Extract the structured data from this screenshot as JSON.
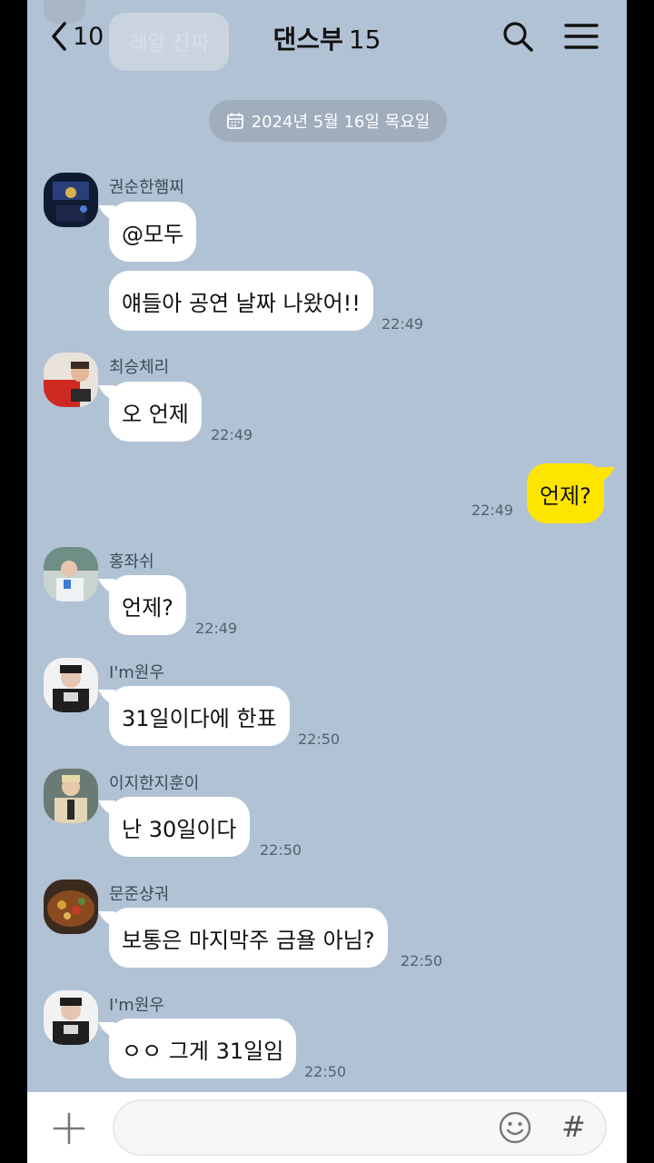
{
  "header": {
    "back_count": "10",
    "title": "댄스부",
    "member_count": "15",
    "ghost_text": "레알 진짜"
  },
  "date_divider": "2024년 5월 16일 목요일",
  "messages": [
    {
      "sender": "권순한햄찌",
      "texts": [
        "@모두",
        "얘들아 공연 날짜 나왔어!!"
      ],
      "time": "22:49"
    },
    {
      "sender": "최승체리",
      "texts": [
        "오 언제"
      ],
      "time": "22:49"
    },
    {
      "mine": true,
      "texts": [
        "언제?"
      ],
      "time": "22:49"
    },
    {
      "sender": "홍좌쉬",
      "texts": [
        "언제?"
      ],
      "time": "22:49"
    },
    {
      "sender": "I'm원우",
      "texts": [
        "31일이다에 한표"
      ],
      "time": "22:50"
    },
    {
      "sender": "이지한지훈이",
      "texts": [
        "난 30일이다"
      ],
      "time": "22:50"
    },
    {
      "sender": "문준샹궈",
      "texts": [
        "보통은 마지막주 금욜 아님?"
      ],
      "time": "22:50"
    },
    {
      "sender": "I'm원우",
      "texts": [
        "ㅇㅇ 그게 31일임"
      ],
      "time": "22:50"
    }
  ],
  "input": {
    "placeholder": "",
    "value": ""
  },
  "icons": [
    "chevron-left-icon",
    "search-icon",
    "menu-icon",
    "calendar-icon",
    "plus-icon",
    "emoji-icon",
    "hash-icon"
  ],
  "colors": {
    "background": "#b1c2d5",
    "my_bubble": "#fee500",
    "other_bubble": "#ffffff"
  }
}
